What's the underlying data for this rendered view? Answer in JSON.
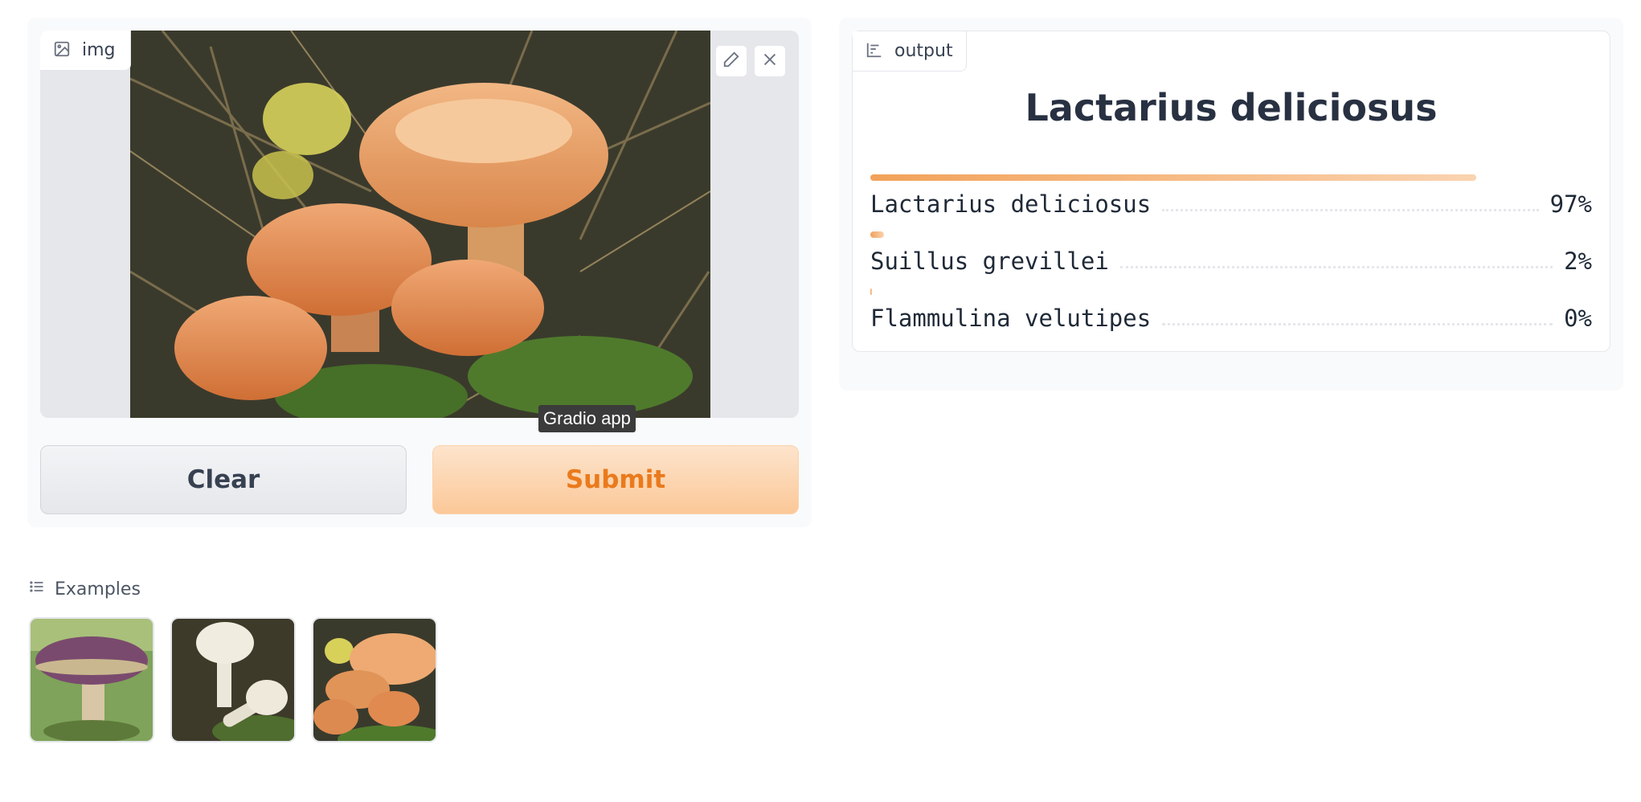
{
  "input": {
    "label": "img",
    "image_icon": "image-icon",
    "edit_icon": "pencil-icon",
    "close_icon": "close-icon",
    "tooltip": "Gradio app"
  },
  "buttons": {
    "clear": "Clear",
    "submit": "Submit"
  },
  "output": {
    "label": "output",
    "label_icon": "bar-chart-icon",
    "top_label": "Lactarius deliciosus",
    "confidences": [
      {
        "name": "Lactarius deliciosus",
        "value": "97%",
        "fraction": 0.97
      },
      {
        "name": "Suillus grevillei",
        "value": "2%",
        "fraction": 0.02
      },
      {
        "name": "Flammulina velutipes",
        "value": "0%",
        "fraction": 0.0
      }
    ]
  },
  "examples": {
    "title": "Examples",
    "icon": "list-icon",
    "items": [
      "example-1",
      "example-2",
      "example-3"
    ]
  },
  "colors": {
    "accent": "#ea7a1d",
    "bar_start": "#f2a25a",
    "bar_end": "#fad3b0"
  }
}
